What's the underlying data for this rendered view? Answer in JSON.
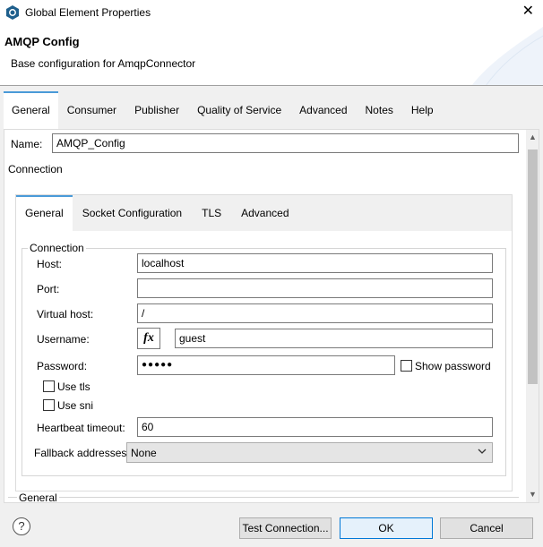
{
  "window": {
    "title": "Global Element Properties",
    "close_glyph": "✕",
    "icon": "app-logo-icon"
  },
  "header": {
    "title": "AMQP Config",
    "subtitle": "Base configuration for AmqpConnector"
  },
  "tabs": [
    {
      "label": "General",
      "active": true
    },
    {
      "label": "Consumer",
      "active": false
    },
    {
      "label": "Publisher",
      "active": false
    },
    {
      "label": "Quality of Service",
      "active": false
    },
    {
      "label": "Advanced",
      "active": false
    },
    {
      "label": "Notes",
      "active": false
    },
    {
      "label": "Help",
      "active": false
    }
  ],
  "form": {
    "name_label": "Name:",
    "name_value": "AMQP_Config",
    "connection_heading": "Connection"
  },
  "inner_tabs": [
    {
      "label": "General",
      "active": true
    },
    {
      "label": "Socket Configuration",
      "active": false
    },
    {
      "label": "TLS",
      "active": false
    },
    {
      "label": "Advanced",
      "active": false
    }
  ],
  "connection": {
    "legend": "Connection",
    "host_label": "Host:",
    "host_value": "localhost",
    "port_label": "Port:",
    "port_value": "",
    "vhost_label": "Virtual host:",
    "vhost_value": "/",
    "username_label": "Username:",
    "fx_label": "fx",
    "username_value": "guest",
    "password_label": "Password:",
    "password_value": "●●●●●",
    "show_password_label": "Show password",
    "use_tls_label": "Use tls",
    "use_sni_label": "Use sni",
    "heartbeat_label": "Heartbeat timeout:",
    "heartbeat_value": "60",
    "fallback_label": "Fallback addresses",
    "fallback_value": "None"
  },
  "lower_section": {
    "label": "General"
  },
  "scrollbar": {
    "up_glyph": "▲",
    "down_glyph": "▼"
  },
  "footer": {
    "help_glyph": "?",
    "test_connection_label": "Test Connection...",
    "ok_label": "OK",
    "cancel_label": "Cancel"
  },
  "colors": {
    "accent": "#4a9ad8",
    "primary_border": "#0078d7"
  }
}
